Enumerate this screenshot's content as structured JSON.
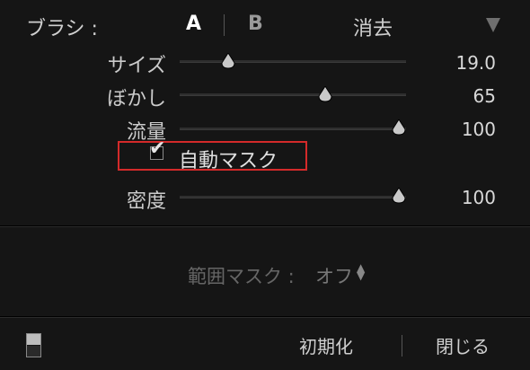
{
  "brush": {
    "title": "ブラシ :",
    "tab_a": "A",
    "tab_b": "B",
    "erase": "消去",
    "menu_icon": "triangle-down-icon"
  },
  "sliders": [
    {
      "label": "サイズ",
      "value": "19.0",
      "position": 0.22
    },
    {
      "label": "ぼかし",
      "value": "65",
      "position": 0.65
    },
    {
      "label": "流量",
      "value": "100",
      "position": 1.0
    },
    {
      "label": "密度",
      "value": "100",
      "position": 1.0
    }
  ],
  "auto_mask": {
    "label": "自動マスク",
    "checked": true
  },
  "range_mask": {
    "label": "範囲マスク :",
    "value": "オフ",
    "icon": "updown-arrows-icon"
  },
  "footer": {
    "reset": "初期化",
    "close": "閉じる",
    "toggle_icon": "panel-toggle-icon"
  },
  "colors": {
    "background": "#151515",
    "highlight_border": "#d42a2a",
    "text": "#cfcfcf"
  }
}
